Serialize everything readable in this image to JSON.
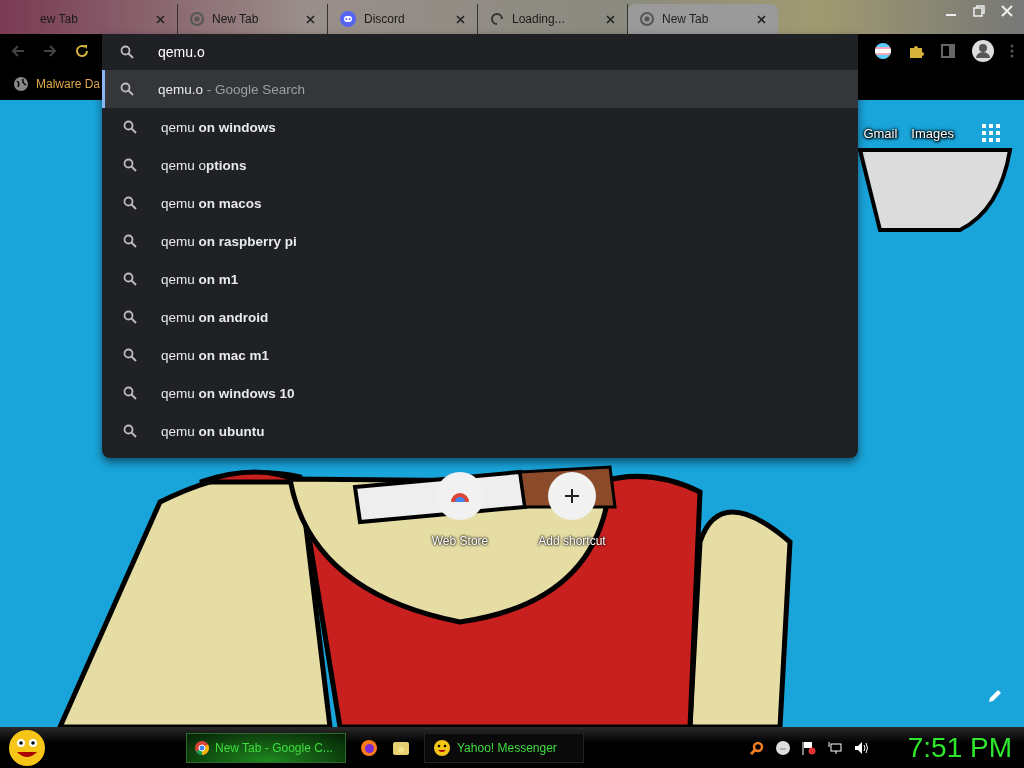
{
  "tabs": [
    {
      "title": "ew Tab",
      "selected": false,
      "kind": "plain"
    },
    {
      "title": "New Tab",
      "selected": false,
      "kind": "chrome"
    },
    {
      "title": "Discord",
      "selected": false,
      "kind": "discord"
    },
    {
      "title": "Loading...",
      "selected": false,
      "kind": "spinner"
    },
    {
      "title": "New Tab",
      "selected": true,
      "kind": "chrome"
    }
  ],
  "bookmarks": [
    "Malware Da"
  ],
  "omnibox": {
    "value": "qemu.o"
  },
  "suggestions": [
    {
      "text": "qemu.o",
      "suffix": " - Google Search",
      "selected": true
    },
    {
      "text": "qemu **on windows**",
      "selected": false
    },
    {
      "text": "qemu o**ptions**",
      "selected": false
    },
    {
      "text": "qemu **on macos**",
      "selected": false
    },
    {
      "text": "qemu **on raspberry pi**",
      "selected": false
    },
    {
      "text": "qemu **on m1**",
      "selected": false
    },
    {
      "text": "qemu **on android**",
      "selected": false
    },
    {
      "text": "qemu **on mac m1**",
      "selected": false
    },
    {
      "text": "qemu **on windows 10**",
      "selected": false
    },
    {
      "text": "qemu **on ubuntu**",
      "selected": false
    }
  ],
  "header_links": [
    "Gmail",
    "Images"
  ],
  "shortcuts": [
    {
      "label": "Web Store",
      "kind": "store"
    },
    {
      "label": "Add shortcut",
      "kind": "add"
    }
  ],
  "taskbar": {
    "items": [
      {
        "label": "New Tab - Google C...",
        "kind": "chrome",
        "active": true
      },
      {
        "kind": "firefox"
      },
      {
        "kind": "folder"
      },
      {
        "label": "Yahoo! Messenger",
        "kind": "yahoo",
        "active": false
      }
    ],
    "clock": "7:51 PM"
  }
}
